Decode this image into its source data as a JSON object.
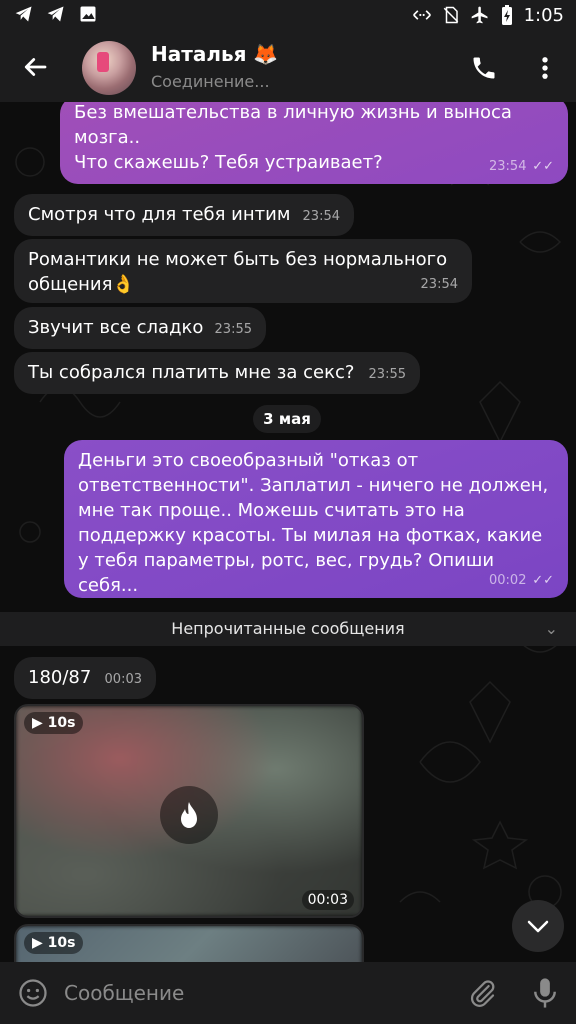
{
  "status_bar": {
    "time": "1:05",
    "icons_left": [
      "telegram-icon",
      "telegram-icon",
      "image-icon"
    ],
    "icons_right": [
      "data-saver-icon",
      "no-sim-icon",
      "airplane-icon",
      "battery-charging-icon"
    ]
  },
  "header": {
    "name": "Наталья 🦊",
    "status": "Соединение..."
  },
  "messages": [
    {
      "dir": "out",
      "text_lines": [
        "Без вмешательства в личную жизнь и выноса",
        "мозга..",
        "Что скажешь? Тебя устраивает?"
      ],
      "time": "23:54",
      "read": true
    },
    {
      "dir": "in",
      "text": "Смотря что для тебя интим",
      "time": "23:54"
    },
    {
      "dir": "in",
      "text_lines": [
        "Романтики не может быть без нормального",
        "общения👌"
      ],
      "time": "23:54"
    },
    {
      "dir": "in",
      "text": "Звучит все сладко",
      "time": "23:55"
    },
    {
      "dir": "in",
      "text": "Ты собрался платить мне за секс?",
      "time": "23:55"
    },
    {
      "dir": "out",
      "text_lines": [
        "Деньги это своеобразный \"отказ от",
        "ответственности\". Заплатил - ничего не должен,",
        "мне так проще.. Можешь считать это на",
        "поддержку красоты. Ты милая на фотках, какие",
        "у тебя параметры, ротс, вес, грудь? Опиши себя..."
      ],
      "time": "00:02",
      "read": true
    },
    {
      "dir": "in",
      "text": "180/87",
      "time": "00:03"
    }
  ],
  "date_separator": "3 мая",
  "unread_separator": "Непрочитанные сообщения",
  "videos": [
    {
      "duration": "10s",
      "time": "00:03"
    },
    {
      "duration": "10s"
    }
  ],
  "input": {
    "placeholder": "Сообщение"
  },
  "colors": {
    "outgoing_bubble": "#7b45c4",
    "incoming_bubble": "#222223",
    "background": "#0d0d0d",
    "header": "#1c1c1d"
  }
}
